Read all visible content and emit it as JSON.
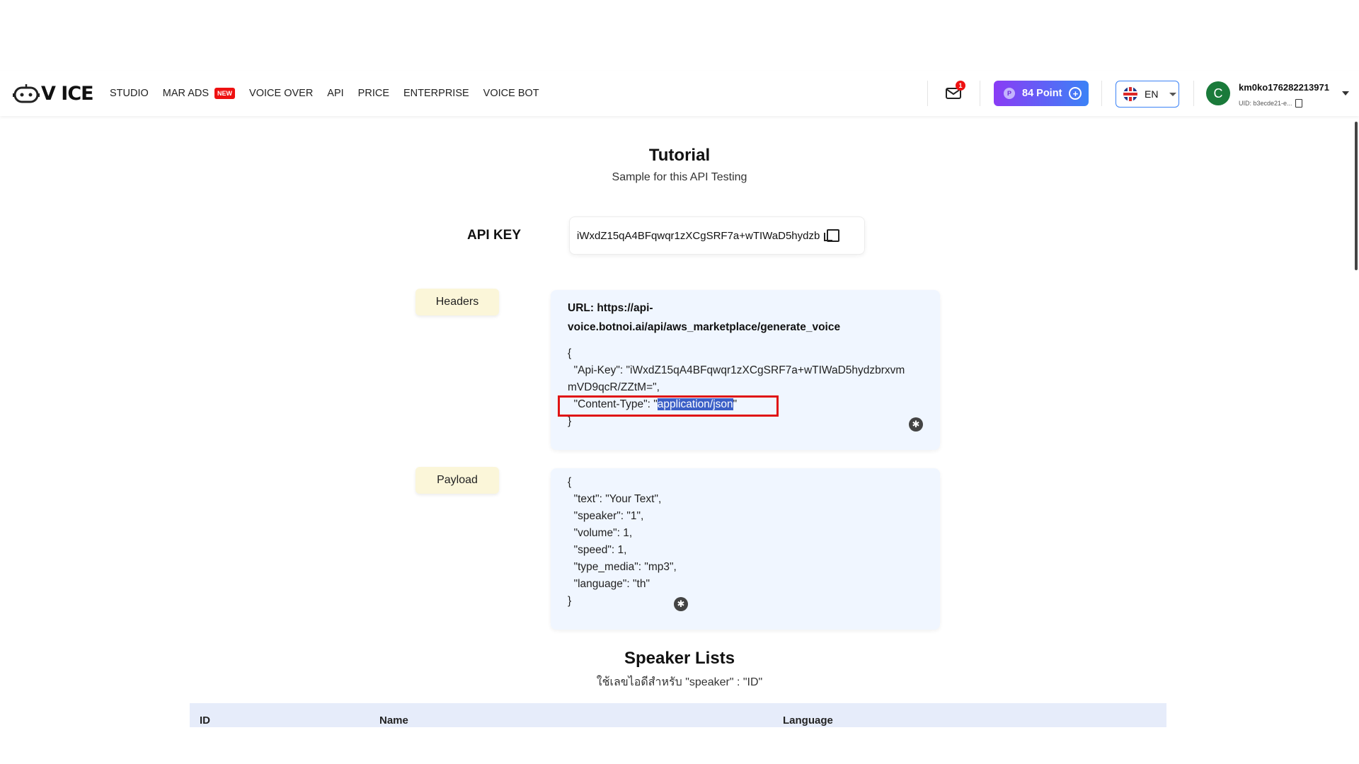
{
  "brand": {
    "logo_text": "V ICE"
  },
  "nav": [
    {
      "label": "STUDIO"
    },
    {
      "label": "MAR ADS",
      "badge": "NEW"
    },
    {
      "label": "VOICE OVER"
    },
    {
      "label": "API"
    },
    {
      "label": "PRICE"
    },
    {
      "label": "ENTERPRISE"
    },
    {
      "label": "VOICE BOT"
    }
  ],
  "header": {
    "mail_count": "1",
    "points_label": "84 Point",
    "points_icon": "P",
    "language": "EN",
    "avatar_letter": "C",
    "username": "km0ko176282213971",
    "uid": "UID: b3ecde21-e..."
  },
  "tutorial": {
    "title": "Tutorial",
    "subtitle": "Sample for this API Testing",
    "api_key_label": "API KEY",
    "api_key_value": "iWxdZ15qA4BFqwqr1zXCgSRF7a+wTIWaD5hydzb"
  },
  "headers_section": {
    "label": "Headers",
    "url_line1": "URL: https://api-",
    "url_line2": "voice.botnoi.ai/api/aws_marketplace/generate_voice",
    "code_open": "{",
    "code_apikey_1": "  \"Api-Key\": \"iWxdZ15qA4BFqwqr1zXCgSRF7a+wTIWaD5hydzbrxvm",
    "code_apikey_2": "mVD9qcR/ZZtM=\",",
    "code_ct_key": "  \"Content-Type\": \"",
    "code_ct_value": "application/json",
    "code_ct_end": "\"",
    "code_close": "}"
  },
  "payload_section": {
    "label": "Payload",
    "lines": [
      "{",
      "  \"text\": \"Your Text\",",
      "  \"speaker\": \"1\",",
      "  \"volume\": 1,",
      "  \"speed\": 1,",
      "  \"type_media\": \"mp3\",",
      "  \"language\": \"th\"",
      "}"
    ]
  },
  "speaker_lists": {
    "title": "Speaker Lists",
    "subtitle": "ใช้เลขไอดีสำหรับ \"speaker\" : \"ID\"",
    "columns": [
      "ID",
      "Name",
      "Language"
    ]
  }
}
